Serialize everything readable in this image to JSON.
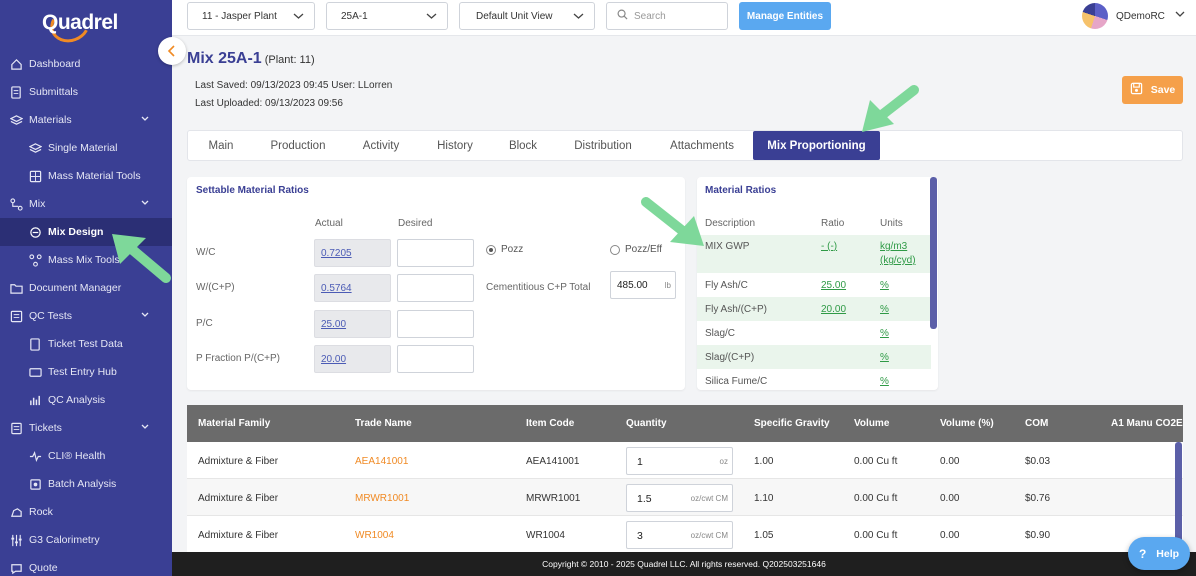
{
  "brand": {
    "logo_text": "Quadrel",
    "accent": "#f08a24",
    "sidebar_bg": "#3a3f94",
    "highlight": "#7ed89a"
  },
  "sidebar": {
    "items": [
      {
        "label": "Dashboard",
        "icon": "home-icon"
      },
      {
        "label": "Submittals",
        "icon": "document-icon"
      },
      {
        "label": "Materials",
        "icon": "layers-icon",
        "expandable": true
      },
      {
        "label": "Single Material",
        "icon": "layers-icon",
        "sub": true
      },
      {
        "label": "Mass Material Tools",
        "icon": "grid-icon",
        "sub": true
      },
      {
        "label": "Mix",
        "icon": "flow-icon",
        "expandable": true
      },
      {
        "label": "Mix Design",
        "icon": "mix-icon",
        "sub": true,
        "active": true
      },
      {
        "label": "Mass Mix Tools",
        "icon": "flow-icon",
        "sub": true
      },
      {
        "label": "Document Manager",
        "icon": "folder-icon"
      },
      {
        "label": "QC Tests",
        "icon": "checklist-icon",
        "expandable": true
      },
      {
        "label": "Ticket Test Data",
        "icon": "document-icon",
        "sub": true
      },
      {
        "label": "Test Entry Hub",
        "icon": "keyboard-icon",
        "sub": true
      },
      {
        "label": "QC Analysis",
        "icon": "bar-chart-icon",
        "sub": true
      },
      {
        "label": "Tickets",
        "icon": "ticket-icon",
        "expandable": true
      },
      {
        "label": "CLI® Health",
        "icon": "pulse-icon",
        "sub": true
      },
      {
        "label": "Batch Analysis",
        "icon": "batch-icon",
        "sub": true
      },
      {
        "label": "Rock",
        "icon": "rock-icon"
      },
      {
        "label": "G3 Calorimetry",
        "icon": "sliders-icon"
      },
      {
        "label": "Quote",
        "icon": "quote-icon"
      }
    ]
  },
  "topbar": {
    "plant": "11 - Jasper Plant",
    "mix": "25A-1",
    "view": "Default Unit View",
    "search_placeholder": "Search",
    "manage_label": "Manage Entities",
    "user": "QDemoRC"
  },
  "header": {
    "title": "Mix 25A-1",
    "plant_note": "(Plant: 11)",
    "last_saved": "Last Saved: 09/13/2023 09:45 User: LLorren",
    "last_uploaded": "Last Uploaded: 09/13/2023 09:56",
    "save_label": "Save"
  },
  "tabs": [
    "Main",
    "Production",
    "Activity",
    "History",
    "Block",
    "Distribution",
    "Attachments",
    "Mix Proportioning"
  ],
  "settable": {
    "title": "Settable Material Ratios",
    "col_actual": "Actual",
    "col_desired": "Desired",
    "rows": [
      {
        "label": "W/C",
        "actual": "0.7205"
      },
      {
        "label": "W/(C+P)",
        "actual": "0.5764"
      },
      {
        "label": "P/C",
        "actual": "25.00"
      },
      {
        "label": "P Fraction P/(C+P)",
        "actual": "20.00"
      }
    ],
    "radio_pozz": "Pozz",
    "radio_pozz_eff": "Pozz/Eff",
    "cementitious_label": "Cementitious C+P Total",
    "cementitious_value": "485.00",
    "cementitious_unit": "lb"
  },
  "ratios": {
    "title": "Material Ratios",
    "col_description": "Description",
    "col_ratio": "Ratio",
    "col_units": "Units",
    "rows": [
      {
        "desc": "MIX GWP",
        "ratio": "- (-)",
        "units": "kg/m3",
        "units2": "(kg/cyd)"
      },
      {
        "desc": "Fly Ash/C",
        "ratio": "25.00",
        "units": "%"
      },
      {
        "desc": "Fly Ash/(C+P)",
        "ratio": "20.00",
        "units": "%"
      },
      {
        "desc": "Slag/C",
        "ratio": "",
        "units": "%"
      },
      {
        "desc": "Slag/(C+P)",
        "ratio": "",
        "units": "%"
      },
      {
        "desc": "Silica Fume/C",
        "ratio": "",
        "units": "%"
      }
    ]
  },
  "materials_table": {
    "columns": [
      "Material Family",
      "Trade Name",
      "Item Code",
      "Quantity",
      "Specific Gravity",
      "Volume",
      "Volume (%)",
      "COM",
      "A1 Manu CO2E"
    ],
    "rows": [
      {
        "family": "Admixture & Fiber",
        "trade": "AEA141001",
        "code": "AEA141001",
        "qty": "1",
        "qty_unit": "oz",
        "sg": "1.00",
        "volume": "0.00 Cu ft",
        "vol_pct": "0.00",
        "com": "$0.03"
      },
      {
        "family": "Admixture & Fiber",
        "trade": "MRWR1001",
        "code": "MRWR1001",
        "qty": "1.5",
        "qty_unit": "oz/cwt CM",
        "sg": "1.10",
        "volume": "0.00 Cu ft",
        "vol_pct": "0.00",
        "com": "$0.76"
      },
      {
        "family": "Admixture & Fiber",
        "trade": "WR1004",
        "code": "WR1004",
        "qty": "3",
        "qty_unit": "oz/cwt CM",
        "sg": "1.05",
        "volume": "0.00 Cu ft",
        "vol_pct": "0.00",
        "com": "$0.90"
      }
    ]
  },
  "footer": {
    "copyright": "Copyright © 2010 - 2025 Quadrel LLC. All rights reserved. Q202503251646"
  },
  "help_label": "Help"
}
